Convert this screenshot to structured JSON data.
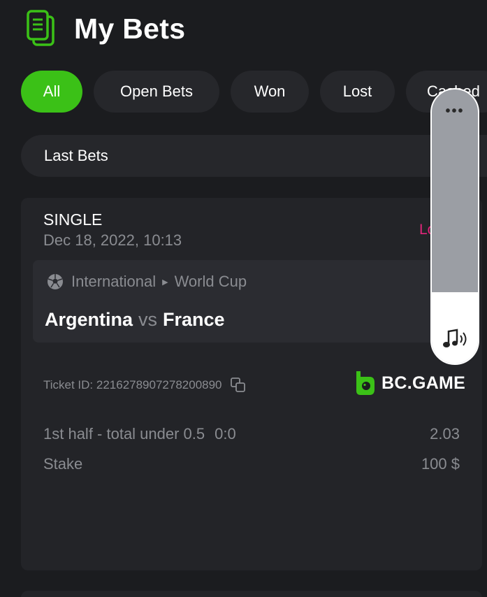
{
  "header": {
    "title": "My Bets",
    "icon": "document-stack-icon"
  },
  "filters": [
    {
      "label": "All",
      "active": true
    },
    {
      "label": "Open Bets",
      "active": false
    },
    {
      "label": "Won",
      "active": false
    },
    {
      "label": "Lost",
      "active": false
    },
    {
      "label": "Cashed",
      "active": false
    }
  ],
  "last_bets": {
    "label": "Last Bets"
  },
  "bet": {
    "type": "SINGLE",
    "date": "Dec 18, 2022, 10:13",
    "status": "Lost",
    "league": {
      "country": "International",
      "name": "World Cup",
      "icon": "soccer-ball-icon"
    },
    "home": "Argentina",
    "vs": "vs",
    "away": "France",
    "ticket_label": "Ticket ID: 2216278907278200890",
    "brand": "BC.GAME",
    "selection": "1st half - total under 0.5",
    "score": "0:0",
    "odds": "2.03",
    "stake_label": "Stake",
    "stake_value": "100 $"
  },
  "volume_overlay": {
    "level": 0.26,
    "icon": "speaker-icon"
  },
  "colors": {
    "accent": "#3bc117",
    "lost": "#e0267a",
    "background": "#1b1c1f"
  }
}
